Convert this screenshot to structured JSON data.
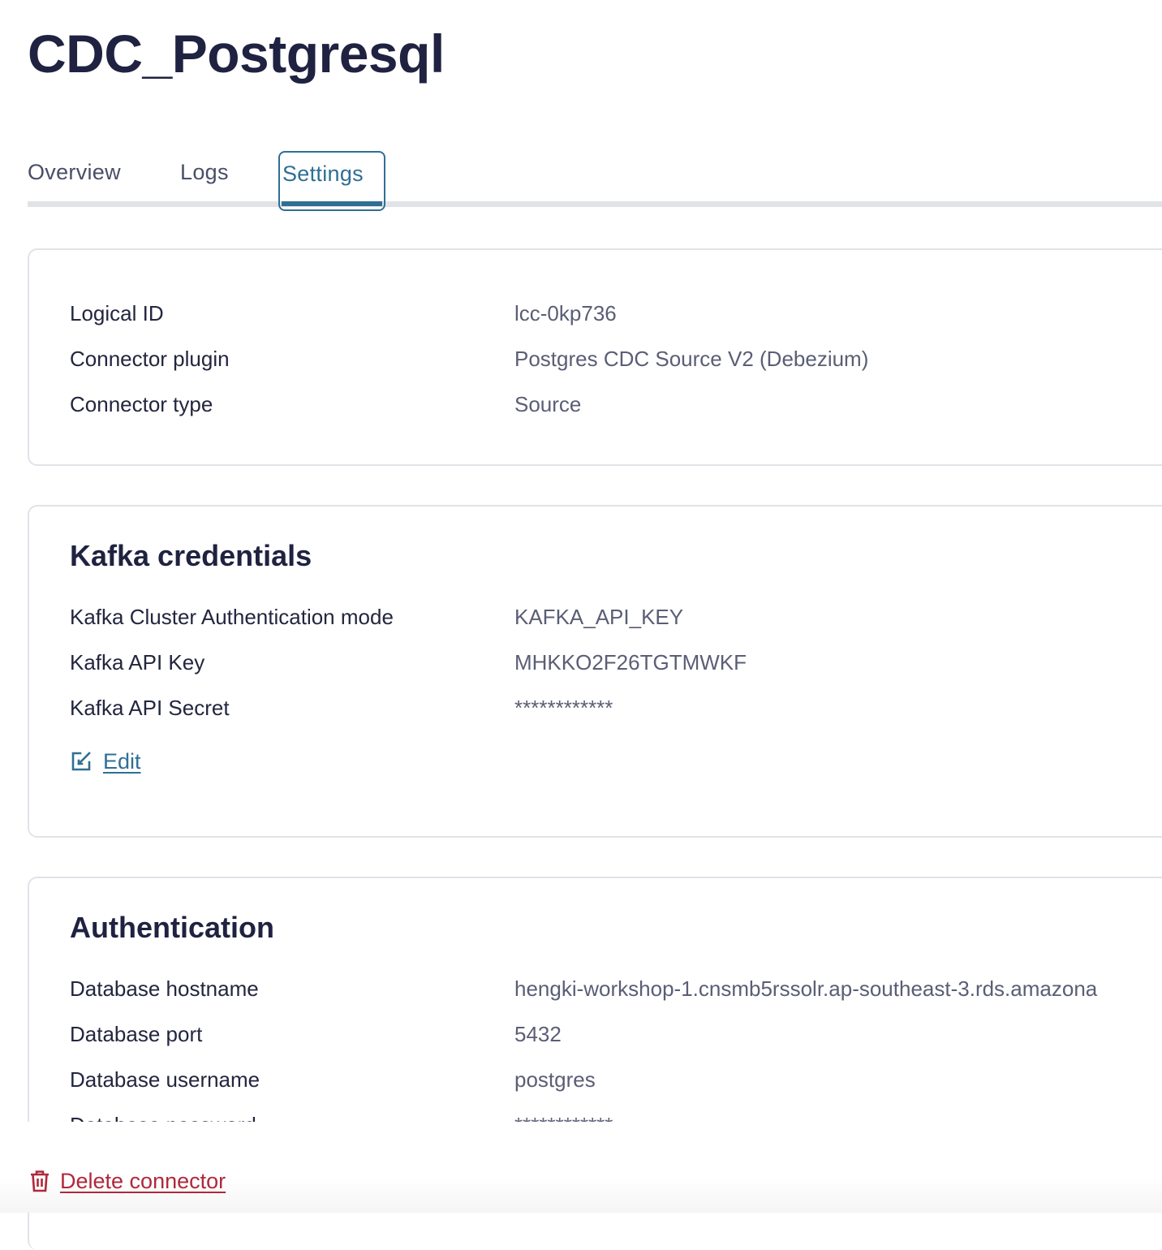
{
  "page": {
    "title": "CDC_Postgresql"
  },
  "tabs": [
    {
      "label": "Overview",
      "active": false
    },
    {
      "label": "Logs",
      "active": false
    },
    {
      "label": "Settings",
      "active": true
    }
  ],
  "general": {
    "rows": [
      {
        "label": "Logical ID",
        "value": "lcc-0kp736"
      },
      {
        "label": "Connector plugin",
        "value": "Postgres CDC Source V2 (Debezium)"
      },
      {
        "label": "Connector type",
        "value": "Source"
      }
    ]
  },
  "kafka_credentials": {
    "heading": "Kafka credentials",
    "rows": [
      {
        "label": "Kafka Cluster Authentication mode",
        "value": "KAFKA_API_KEY"
      },
      {
        "label": "Kafka API Key",
        "value": "MHKKO2F26TGTMWKF"
      },
      {
        "label": "Kafka API Secret",
        "value": "************"
      }
    ],
    "edit_label": "Edit",
    "edit_icon": "edit-icon"
  },
  "authentication": {
    "heading": "Authentication",
    "rows": [
      {
        "label": "Database hostname",
        "value": "hengki-workshop-1.cnsmb5rssolr.ap-southeast-3.rds.amazona"
      },
      {
        "label": "Database port",
        "value": "5432"
      },
      {
        "label": "Database username",
        "value": "postgres"
      },
      {
        "label": "Database password",
        "value": "************"
      }
    ]
  },
  "footer": {
    "delete_label": "Delete connector",
    "delete_icon": "trash-icon"
  },
  "colors": {
    "accent": "#2f6f94",
    "danger": "#b0283b",
    "title": "#1f2240",
    "border": "#e2e3e8"
  }
}
